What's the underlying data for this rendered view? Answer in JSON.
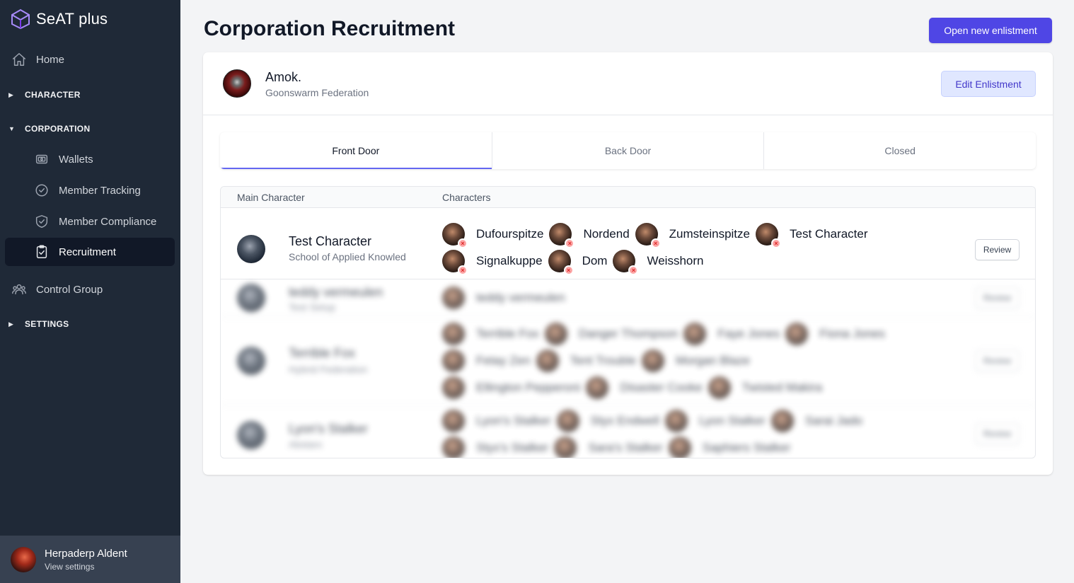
{
  "brand": {
    "name": "SeAT plus"
  },
  "sidebar": {
    "home": "Home",
    "character": "CHARACTER",
    "corporation": "CORPORATION",
    "corp_items": [
      {
        "label": "Wallets",
        "icon": "wallet-icon"
      },
      {
        "label": "Member Tracking",
        "icon": "badge-check-icon"
      },
      {
        "label": "Member Compliance",
        "icon": "shield-check-icon"
      },
      {
        "label": "Recruitment",
        "icon": "clipboard-check-icon"
      }
    ],
    "control_group": "Control Group",
    "settings": "SETTINGS"
  },
  "user": {
    "name": "Herpaderp Aldent",
    "sub": "View settings"
  },
  "page": {
    "title": "Corporation Recruitment",
    "open_button": "Open new enlistment"
  },
  "corporation": {
    "name": "Amok.",
    "alliance": "Goonswarm Federation",
    "edit_button": "Edit Enlistment"
  },
  "tabs": [
    "Front Door",
    "Back Door",
    "Closed"
  ],
  "table": {
    "headers": {
      "main": "Main Character",
      "characters": "Characters"
    },
    "rows": [
      {
        "main": "Test Character",
        "corp": "School of Applied Knowledge",
        "characters": [
          "Dufourspitze",
          "Nordend",
          "Zumsteinspitze",
          "Test Character",
          "Signalkuppe",
          "Dom",
          "Weisshorn"
        ],
        "review": "Review"
      },
      {
        "main": "teddy vermeulen",
        "corp": "Test Setup",
        "characters": [
          "teddy vermeulen"
        ],
        "review": "Review"
      },
      {
        "main": "Terrible Fox",
        "corp": "Hybrid Federation",
        "characters": [
          "Terrible Fox",
          "Danger Thompson",
          "Faye Jones",
          "Fiona Jones",
          "Fetay Zen",
          "Tent Trouble",
          "Morgan Blaze",
          "Ellington Pepperoni",
          "Disaster Cooke",
          "Twisted Makira"
        ],
        "review": "Review"
      },
      {
        "main": "Lyon's Stalker",
        "corp": "Abstarx",
        "characters": [
          "Lyon's Stalker",
          "Styx Endwell",
          "Lyon Stalker",
          "Sarai Jado",
          "Styx's Stalker",
          "Sara's Stalker",
          "Saphiers Stalker"
        ],
        "review": "Review"
      }
    ]
  },
  "colors": {
    "accent": "#4f46e5",
    "sidebar": "#1f2937",
    "tab_indicator": "#6366f1"
  }
}
